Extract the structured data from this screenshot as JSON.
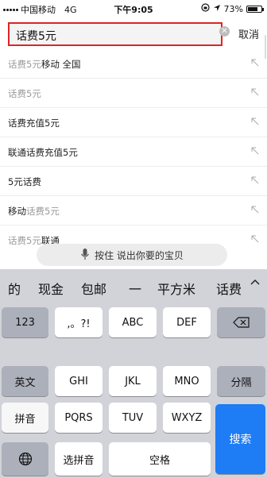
{
  "status_bar": {
    "carrier": "中国移动",
    "network": "4G",
    "time": "下午9:05",
    "battery": "73%",
    "battery_level": 0.73
  },
  "search": {
    "value": "话费5元",
    "cancel_label": "取消",
    "clear_icon": "clear-icon"
  },
  "suggestions": [
    {
      "muted": "话费5元",
      "normal": "移动 全国"
    },
    {
      "muted": "话费5元",
      "normal": ""
    },
    {
      "muted": "",
      "normal": "话费充值5元"
    },
    {
      "muted": "",
      "normal": "联通话费充值5元"
    },
    {
      "muted": "",
      "normal": "5元话费"
    },
    {
      "muted": "话费5元",
      "normal": "移动",
      "order": "normal-first"
    },
    {
      "muted": "话费5元",
      "normal": "联通",
      "partial": true
    }
  ],
  "voice": {
    "label": "按住  说出你要的宝贝"
  },
  "keyboard": {
    "candidates": [
      "的",
      "现金",
      "包邮",
      "一",
      "平方米",
      "话费"
    ],
    "keys": {
      "num": "123",
      "punct": ",。?!",
      "abc": "ABC",
      "def": "DEF",
      "en": "英文",
      "ghi": "GHI",
      "jkl": "JKL",
      "mno": "MNO",
      "fenci": "分隔",
      "pinyin": "拼音",
      "pqrs": "PQRS",
      "tuv": "TUV",
      "wxyz": "WXYZ",
      "search": "搜索",
      "select_pinyin": "选拼音",
      "space": "空格"
    },
    "accent_color": "#1e7cf5"
  }
}
